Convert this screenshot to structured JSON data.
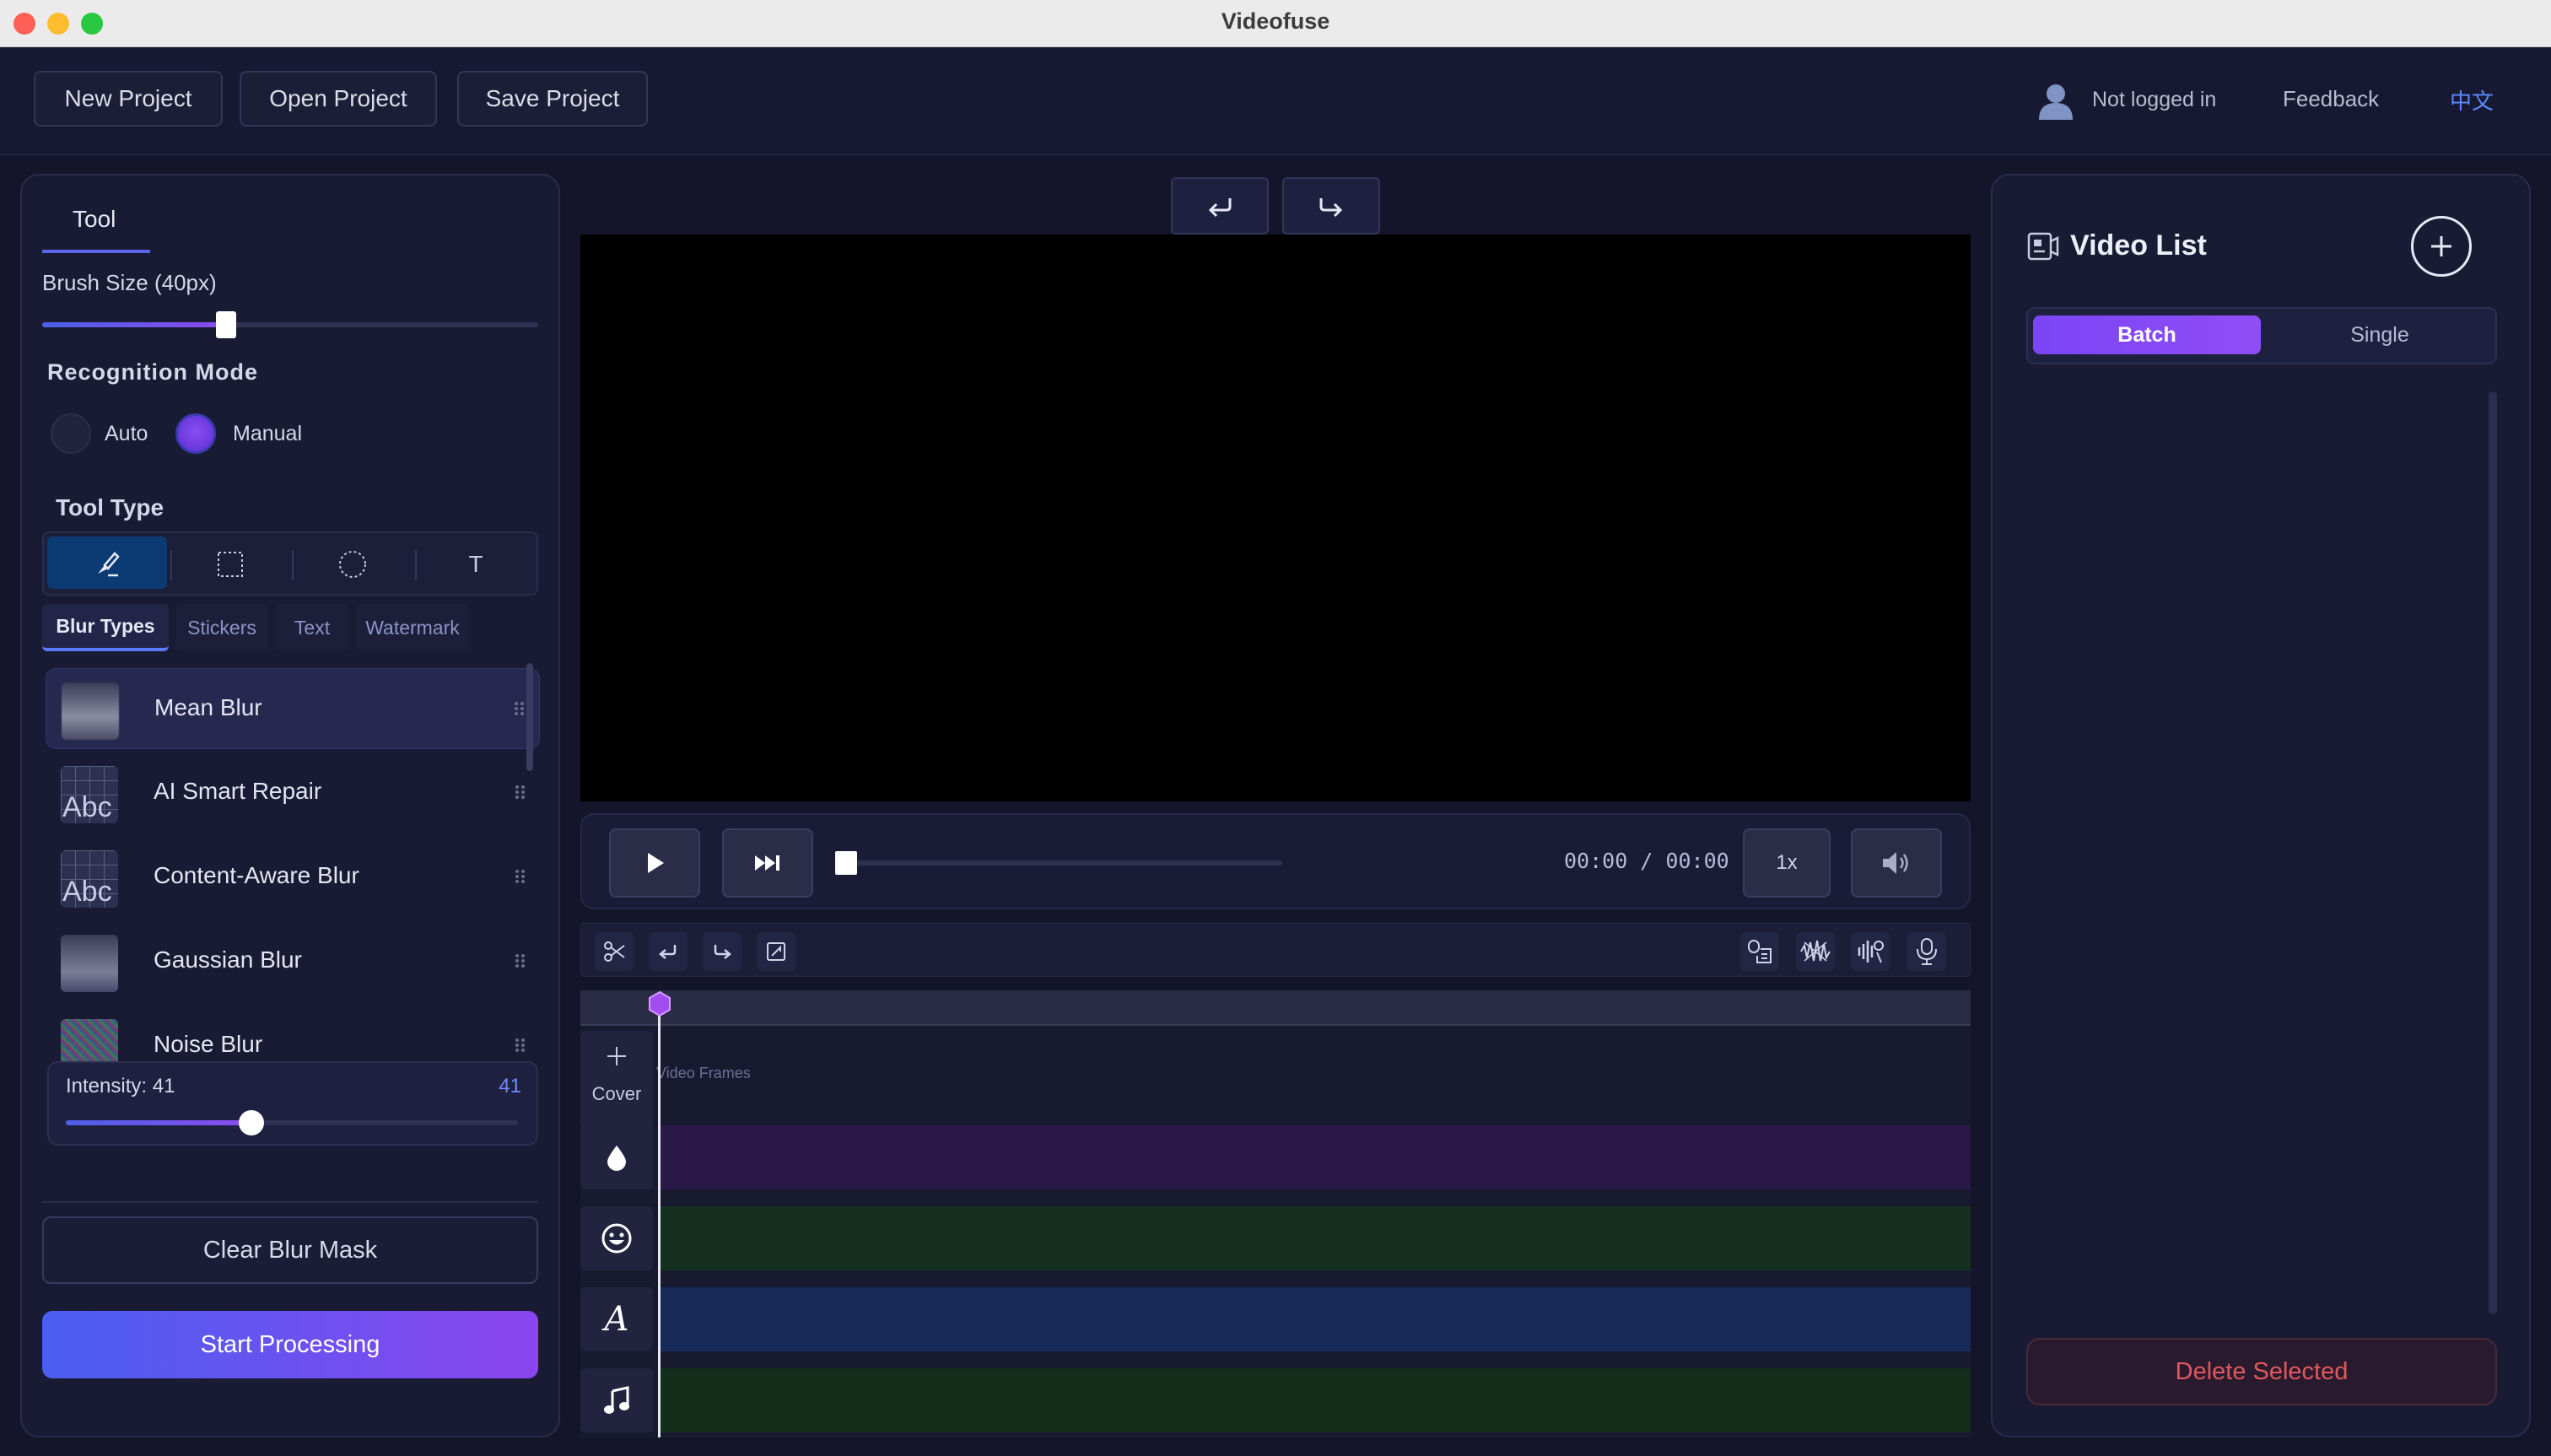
{
  "window": {
    "title": "Videofuse"
  },
  "header": {
    "new_project": "New Project",
    "open_project": "Open Project",
    "save_project": "Save Project",
    "login_status": "Not logged in",
    "feedback": "Feedback",
    "language": "中文"
  },
  "left": {
    "tab_label": "Tool",
    "brush_size_label": "Brush Size (40px)",
    "brush_size_value": 40,
    "brush_slider_fraction": 0.37,
    "recognition_mode_label": "Recognition Mode",
    "mode_auto": "Auto",
    "mode_manual": "Manual",
    "selected_mode": "Manual",
    "tool_type_label": "Tool Type",
    "tools": [
      {
        "icon": "brush-icon",
        "selected": true
      },
      {
        "icon": "rectangle-select-icon",
        "selected": false
      },
      {
        "icon": "ellipse-select-icon",
        "selected": false
      },
      {
        "icon": "text-tool-icon",
        "glyph": "T",
        "selected": false
      }
    ],
    "category_tabs": [
      "Blur Types",
      "Stickers",
      "Text",
      "Watermark"
    ],
    "active_category": "Blur Types",
    "blur_types": [
      {
        "label": "Mean Blur",
        "selected": true
      },
      {
        "label": "AI Smart Repair",
        "selected": false
      },
      {
        "label": "Content-Aware Blur",
        "selected": false
      },
      {
        "label": "Gaussian Blur",
        "selected": false
      },
      {
        "label": "Noise Blur",
        "selected": false
      }
    ],
    "thumb_text": "Abc",
    "intensity_label": "Intensity: 41",
    "intensity_value": "41",
    "intensity_fraction": 0.41,
    "clear_mask": "Clear Blur Mask",
    "start_processing": "Start Processing"
  },
  "player": {
    "time_display": "00:00 / 00:00",
    "speed": "1x",
    "progress_fraction": 0
  },
  "timeline": {
    "cover_label": "Cover",
    "frames_label": "Video Frames",
    "tracks": [
      {
        "icon": "drop-icon",
        "color": "#2a1848"
      },
      {
        "icon": "smiley-icon",
        "color": "#15301f"
      },
      {
        "icon": "text-a-icon",
        "glyph": "A",
        "color": "#172a5a"
      },
      {
        "icon": "music-note-icon",
        "color": "#142e1c"
      }
    ]
  },
  "right": {
    "title": "Video List",
    "tab_batch": "Batch",
    "tab_single": "Single",
    "active_tab": "Batch",
    "delete_selected": "Delete Selected"
  },
  "colors": {
    "accent_purple": "#7c45f5",
    "accent_blue": "#4a5ff0",
    "danger_red": "#e0585f",
    "link_blue": "#5b8bff"
  }
}
